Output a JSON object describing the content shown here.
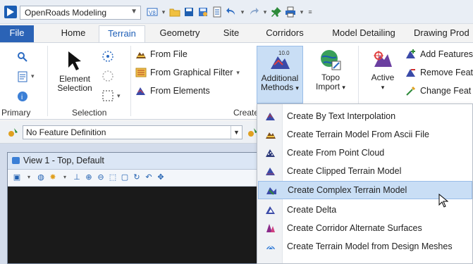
{
  "workflow": {
    "label": "OpenRoads Modeling"
  },
  "tabs": [
    {
      "label": "File"
    },
    {
      "label": "Home"
    },
    {
      "label": "Terrain"
    },
    {
      "label": "Geometry"
    },
    {
      "label": "Site"
    },
    {
      "label": "Corridors"
    },
    {
      "label": "Model Detailing"
    },
    {
      "label": "Drawing Prod"
    }
  ],
  "ribbon": {
    "groups": {
      "primary": "Primary",
      "selection": "Selection",
      "create": "Create"
    },
    "element_selection": {
      "line1": "Element",
      "line2": "Selection"
    },
    "from_file": "From File",
    "from_graphical_filter": "From Graphical Filter",
    "from_elements": "From Elements",
    "additional_methods": {
      "line1": "Additional",
      "line2": "Methods"
    },
    "topo_import": {
      "line1": "Topo",
      "line2": "Import"
    },
    "active": "Active",
    "add_features": "Add Features",
    "remove_features": "Remove Feat",
    "change_features": "Change Feat"
  },
  "feature_definition": {
    "value": "No Feature Definition"
  },
  "view": {
    "title": "View 1 - Top, Default"
  },
  "menu": {
    "items": [
      {
        "label": "Create By Text Interpolation"
      },
      {
        "label": "Create Terrain Model From Ascii File"
      },
      {
        "label": "Create From Point Cloud"
      },
      {
        "label": "Create Clipped Terrain Model"
      },
      {
        "label": "Create Complex Terrain Model"
      },
      {
        "label": "Create Delta"
      },
      {
        "label": "Create Corridor Alternate Surfaces"
      },
      {
        "label": "Create Terrain Model from Design Meshes"
      }
    ],
    "hovered_index": 4
  },
  "colors": {
    "file_tab": "#2b63b6",
    "active_tab_text": "#1e5fb7",
    "menu_hover": "#c9def5"
  }
}
